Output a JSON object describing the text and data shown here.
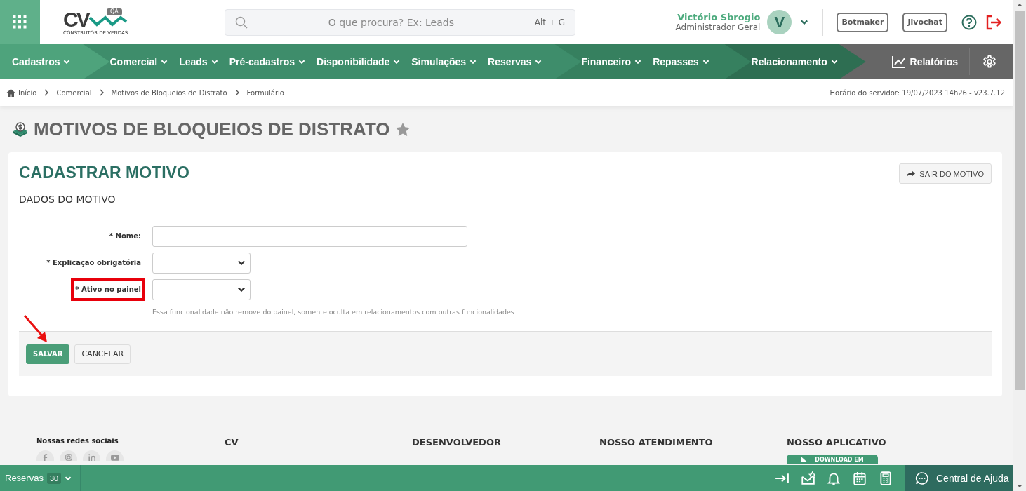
{
  "header": {
    "logo": {
      "mark": "CV",
      "badge": "QA",
      "tagline": "CONSTRUTOR DE VENDAS"
    },
    "search": {
      "placeholder": "O que procura? Ex: Leads",
      "shortcut": "Alt + G"
    },
    "user": {
      "name": "Victório Sbrogio",
      "role": "Administrador Geral",
      "initial": "V"
    },
    "buttons": [
      "Botmaker",
      "Jivochat"
    ]
  },
  "nav": {
    "groups": [
      {
        "items": [
          "Cadastros"
        ]
      },
      {
        "items": [
          "Comercial",
          "Leads",
          "Pré-cadastros",
          "Disponibilidade",
          "Simulações",
          "Reservas"
        ]
      },
      {
        "items": [
          "Financeiro",
          "Repasses"
        ]
      },
      {
        "items": [
          "Relacionamento"
        ]
      }
    ],
    "reports": "Relatórios"
  },
  "breadcrumb": [
    "Início",
    "Comercial",
    "Motivos de Bloqueios de Distrato",
    "Formulário"
  ],
  "server_time": "Horário do servidor: 19/07/2023 14h26 - v23.7.12",
  "page_title": "MOTIVOS DE BLOQUEIOS DE DISTRATO",
  "form": {
    "title": "CADASTRAR MOTIVO",
    "exit_button": "SAIR DO MOTIVO",
    "section": "DADOS DO MOTIVO",
    "fields": [
      {
        "kind": "text",
        "label": "* Nome:",
        "highlighted": false
      },
      {
        "kind": "select",
        "label": "* Explicação obrigatória",
        "highlighted": false
      },
      {
        "kind": "select",
        "label": "* Ativo no painel",
        "highlighted": true,
        "help": "Essa funcionalidade não remove do painel, somente oculta em relacionamentos com outras funcionalidades"
      }
    ],
    "buttons": [
      {
        "label": "SALVAR",
        "primary": true
      },
      {
        "label": "CANCELAR",
        "primary": false
      }
    ],
    "pointer_arrow": true
  },
  "footer": {
    "social_title": "Nossas redes sociais",
    "columns": [
      "CV",
      "DESENVOLVEDOR",
      "NOSSO ATENDIMENTO",
      "NOSSO APLICATIVO"
    ],
    "app_badge": "DOWNLOAD EM"
  },
  "bottom_bar": {
    "label": "Reservas",
    "count": "30",
    "help": "Central de Ajuda"
  }
}
